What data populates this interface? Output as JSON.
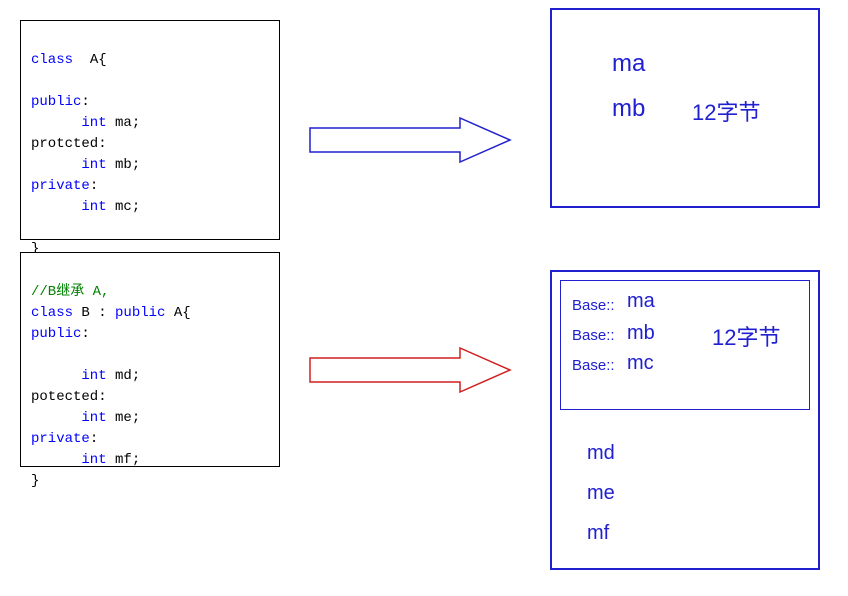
{
  "codeA": {
    "l1a": "class",
    "l1b": "  A{",
    "l2": "",
    "l3a": "public",
    "l3b": ":",
    "l4a": "      int",
    "l4b": " ma;",
    "l5a": "protcted:",
    "l6a": "      int",
    "l6b": " mb;",
    "l7a": "private",
    "l7b": ":",
    "l8a": "      int",
    "l8b": " mc;",
    "l9": "",
    "l10": "}"
  },
  "codeB": {
    "l1": "//B继承 A,",
    "l2a": "class",
    "l2b": " B : ",
    "l2c": "public",
    "l2d": " A{",
    "l3a": "public",
    "l3b": ":",
    "l4": "",
    "l5a": "      int",
    "l5b": " md;",
    "l6": "potected:",
    "l7a": "      int",
    "l7b": " me;",
    "l8a": "private",
    "l8b": ":",
    "l9a": "      int",
    "l9b": " mf;",
    "l10": "}"
  },
  "memA": {
    "ma": "ma",
    "mb": "mb",
    "size": "12字节"
  },
  "memB": {
    "base_prefix": "Base::",
    "ma": "ma",
    "mb": "mb",
    "mc": "mc",
    "size": "12字节",
    "md": "md",
    "me": "me",
    "mf": "mf"
  }
}
